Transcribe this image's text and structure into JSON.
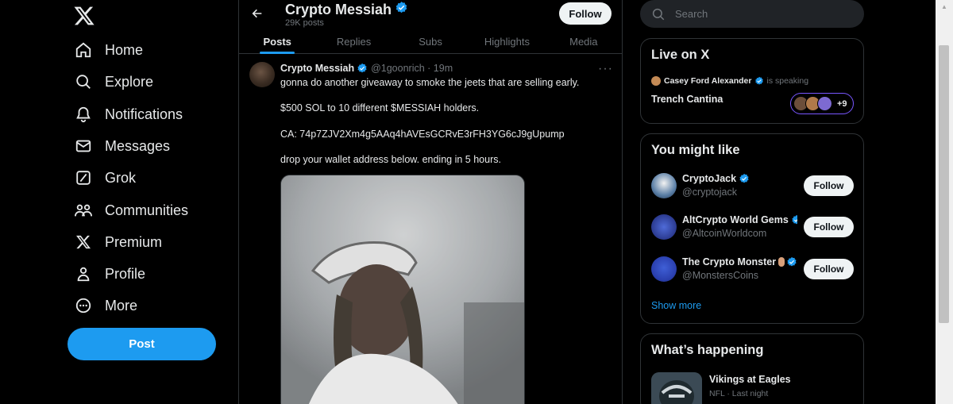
{
  "nav": {
    "items": [
      {
        "label": "Home",
        "icon": "home-icon"
      },
      {
        "label": "Explore",
        "icon": "search-icon"
      },
      {
        "label": "Notifications",
        "icon": "bell-icon"
      },
      {
        "label": "Messages",
        "icon": "mail-icon"
      },
      {
        "label": "Grok",
        "icon": "grok-icon"
      },
      {
        "label": "Communities",
        "icon": "people-icon"
      },
      {
        "label": "Premium",
        "icon": "x-logo-icon"
      },
      {
        "label": "Profile",
        "icon": "person-icon"
      },
      {
        "label": "More",
        "icon": "more-circle-icon"
      }
    ],
    "post_label": "Post"
  },
  "profile": {
    "name": "Crypto Messiah",
    "posts_count": "29K posts",
    "follow_label": "Follow",
    "tabs": [
      "Posts",
      "Replies",
      "Subs",
      "Highlights",
      "Media"
    ],
    "active_tab": "Posts"
  },
  "tweet": {
    "author_name": "Crypto Messiah",
    "handle_time": "@1goonrich · 19m",
    "lines": [
      "gonna do another giveaway to smoke the jeets that are selling early.",
      "$500 SOL to 10 different $MESSIAH holders.",
      "CA: 74p7ZJV2Xm4g5AAq4hAVEsGCRvE3rFH3YG6cJ9gUpump",
      "drop your wallet address below. ending in 5 hours."
    ],
    "more_label": "···"
  },
  "sidebar": {
    "search_placeholder": "Search",
    "live": {
      "title": "Live on X",
      "speaker": "Casey Ford Alexander",
      "status": "is speaking",
      "space_title": "Trench Cantina",
      "listener_count": "+9"
    },
    "who_to_follow": {
      "title": "You might like",
      "accounts": [
        {
          "name": "CryptoJack",
          "handle": "@cryptojack",
          "follow": "Follow"
        },
        {
          "name": "AltCrypto World Gems",
          "handle": "@AltcoinWorldcom",
          "follow": "Follow"
        },
        {
          "name": "The Crypto Monster",
          "handle": "@MonstersCoins",
          "follow": "Follow"
        }
      ],
      "show_more": "Show more"
    },
    "happening": {
      "title": "What’s happening",
      "trend_title": "Vikings at Eagles",
      "trend_meta": "NFL · Last night"
    }
  },
  "colors": {
    "accent": "#1d9bf0",
    "verified": "#1d9bf0",
    "background": "#000000",
    "border": "#2f3336",
    "muted_text": "#71767b"
  }
}
